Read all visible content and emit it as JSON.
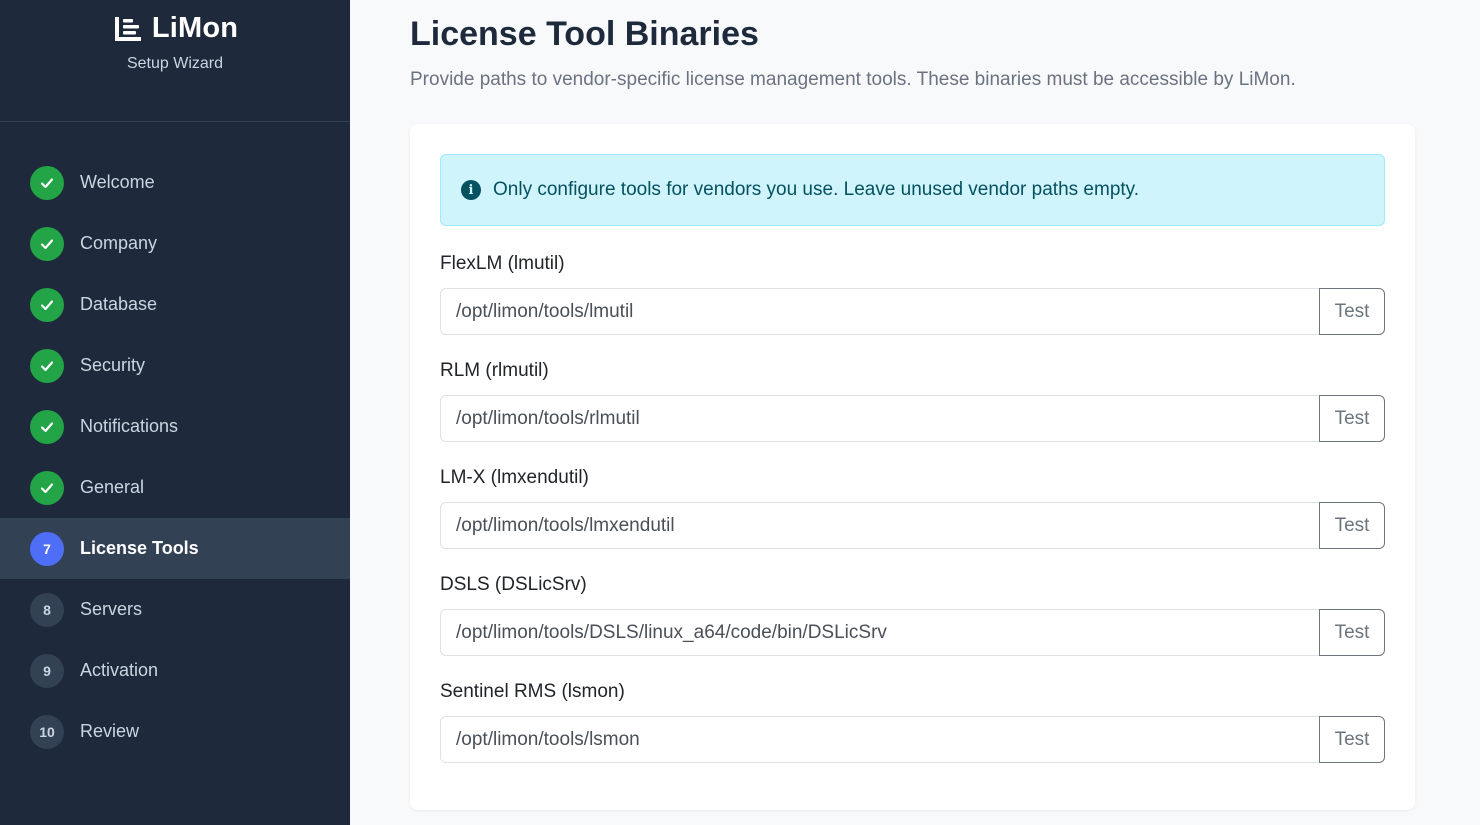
{
  "brand": {
    "name": "LiMon",
    "subtitle": "Setup Wizard"
  },
  "steps": [
    {
      "number": "1",
      "label": "Welcome",
      "status": "done"
    },
    {
      "number": "2",
      "label": "Company",
      "status": "done"
    },
    {
      "number": "3",
      "label": "Database",
      "status": "done"
    },
    {
      "number": "4",
      "label": "Security",
      "status": "done"
    },
    {
      "number": "5",
      "label": "Notifications",
      "status": "done"
    },
    {
      "number": "6",
      "label": "General",
      "status": "done"
    },
    {
      "number": "7",
      "label": "License Tools",
      "status": "active"
    },
    {
      "number": "8",
      "label": "Servers",
      "status": "pending"
    },
    {
      "number": "9",
      "label": "Activation",
      "status": "pending"
    },
    {
      "number": "10",
      "label": "Review",
      "status": "pending"
    }
  ],
  "main": {
    "title": "License Tool Binaries",
    "description": "Provide paths to vendor-specific license management tools. These binaries must be accessible by LiMon.",
    "alert": {
      "icon": "info-circle-icon",
      "text": "Only configure tools for vendors you use. Leave unused vendor paths empty."
    },
    "fields": [
      {
        "label": "FlexLM (lmutil)",
        "value": "/opt/limon/tools/lmutil",
        "button": "Test"
      },
      {
        "label": "RLM (rlmutil)",
        "value": "/opt/limon/tools/rlmutil",
        "button": "Test"
      },
      {
        "label": "LM-X (lmxendutil)",
        "value": "/opt/limon/tools/lmxendutil",
        "button": "Test"
      },
      {
        "label": "DSLS (DSLicSrv)",
        "value": "/opt/limon/tools/DSLS/linux_a64/code/bin/DSLicSrv",
        "button": "Test"
      },
      {
        "label": "Sentinel RMS (lsmon)",
        "value": "/opt/limon/tools/lsmon",
        "button": "Test"
      }
    ]
  },
  "colors": {
    "sidebar_bg": "#1e293b",
    "active_step_bg": "#334155",
    "done_badge": "#22a447",
    "active_badge": "#4f6ef7",
    "alert_bg": "#cff4fc",
    "alert_text": "#055160"
  }
}
